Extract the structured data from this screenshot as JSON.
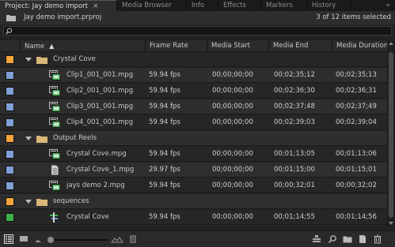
{
  "tabs": [
    {
      "label": "Project: Jay demo import",
      "active": true
    },
    {
      "label": "Media Browser",
      "active": false
    },
    {
      "label": "Info",
      "active": false
    },
    {
      "label": "Effects",
      "active": false
    },
    {
      "label": "Markers",
      "active": false
    },
    {
      "label": "History",
      "active": false
    }
  ],
  "overflow_glyph": "»",
  "project": {
    "file_name": "Jay demo import.prproj",
    "selection_count": "3 of 12 items selected"
  },
  "search": {
    "value": "",
    "placeholder": ""
  },
  "columns": {
    "name": "Name",
    "frame_rate": "Frame Rate",
    "media_start": "Media Start",
    "media_end": "Media End",
    "media_duration": "Media Duration"
  },
  "label_colors": {
    "bin": "#f5a43a",
    "clip": "#7f9fd6",
    "sequence": "#3fb14c"
  },
  "rows": [
    {
      "type": "bin",
      "color": "bin",
      "name": "Crystal Cove"
    },
    {
      "type": "clip",
      "icon": "video-clip-icon",
      "color": "clip",
      "name": "Clip1_001_001.mpg",
      "frame_rate": "59.94 fps",
      "media_start": "00;00;00;00",
      "media_end": "00;02;35;12",
      "media_duration": "00;02;35;13"
    },
    {
      "type": "clip",
      "icon": "video-clip-icon",
      "color": "clip",
      "name": "Clip2_001_001.mpg",
      "frame_rate": "59.94 fps",
      "media_start": "00;00;00;00",
      "media_end": "00;02;36;30",
      "media_duration": "00;02;36;31"
    },
    {
      "type": "clip",
      "icon": "video-clip-icon",
      "color": "clip",
      "name": "Clip3_001_001.mpg",
      "frame_rate": "59.94 fps",
      "media_start": "00;00;00;00",
      "media_end": "00;02;37;48",
      "media_duration": "00;02;37;49"
    },
    {
      "type": "clip",
      "icon": "video-clip-icon",
      "color": "clip",
      "name": "Clip4_001_001.mpg",
      "frame_rate": "59.94 fps",
      "media_start": "00;00;00;00",
      "media_end": "00;02;39;03",
      "media_duration": "00;02;39;04"
    },
    {
      "type": "bin",
      "color": "bin",
      "name": "Output Reels"
    },
    {
      "type": "clip",
      "icon": "video-clip-icon",
      "color": "clip",
      "name": "Crystal Cove.mpg",
      "frame_rate": "59.94 fps",
      "media_start": "00;00;00;00",
      "media_end": "00;01;13;05",
      "media_duration": "00;01;13;06"
    },
    {
      "type": "clip",
      "icon": "document-icon",
      "color": "clip",
      "name": "Crystal Cove_1.mpg",
      "frame_rate": "29.97 fps",
      "media_start": "00;00;00;00",
      "media_end": "00;01;15;00",
      "media_duration": "00;01;15;01"
    },
    {
      "type": "clip",
      "icon": "video-clip-icon",
      "color": "clip",
      "name": "jays demo 2.mpg",
      "frame_rate": "59.94 fps",
      "media_start": "00;00;00;00",
      "media_end": "00;00;32;01",
      "media_duration": "00;00;32;02"
    },
    {
      "type": "bin",
      "color": "bin",
      "name": "sequences"
    },
    {
      "type": "sequence",
      "icon": "sequence-icon",
      "color": "sequence",
      "name": "Crystal Cove",
      "frame_rate": "59.94 fps",
      "media_start": "00;00;00;00",
      "media_end": "00;01;14;55",
      "media_duration": "00;01;14;56"
    }
  ]
}
